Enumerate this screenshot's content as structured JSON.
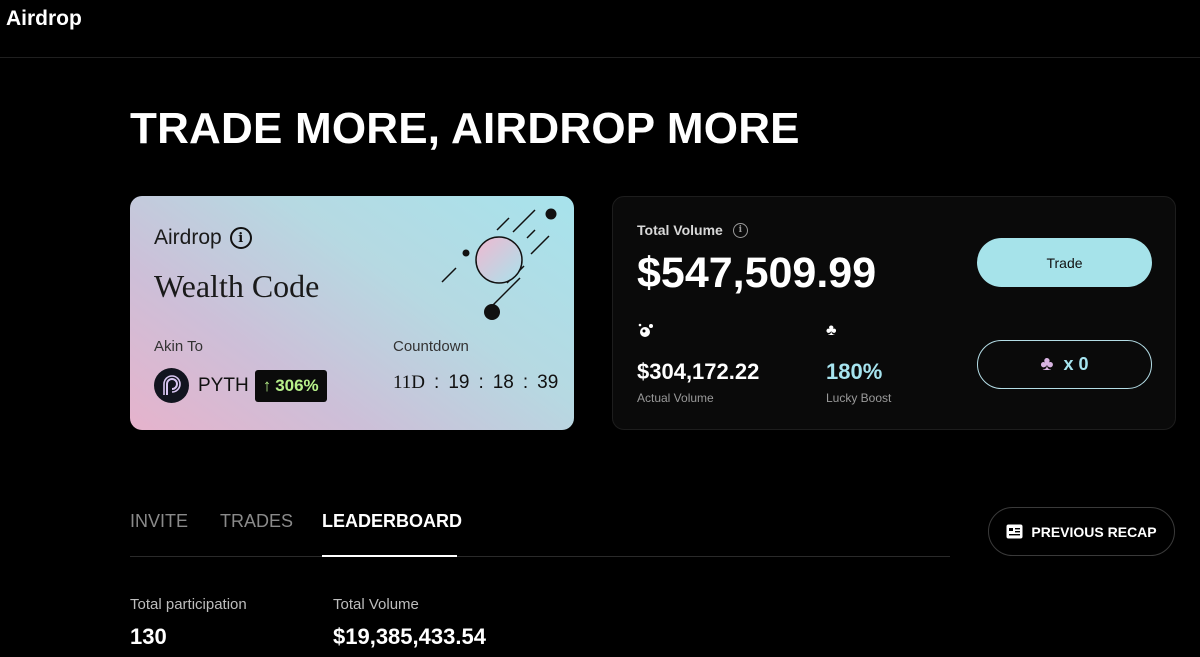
{
  "app": {
    "title": "Airdrop"
  },
  "hero": {
    "title": "TRADE MORE, AIRDROP MORE"
  },
  "airdrop_card": {
    "label": "Airdrop",
    "name": "Wealth Code",
    "akin_label": "Akin To",
    "token_symbol": "PYTH",
    "change_pct": "306%",
    "change_color": "#b7f08a",
    "countdown_label": "Countdown",
    "countdown": {
      "days": "11D",
      "hours": "19",
      "minutes": "18",
      "seconds": "39",
      "separator": ":"
    }
  },
  "volume_card": {
    "total_label": "Total Volume",
    "total_value": "$547,509.99",
    "actual_value": "$304,172.22",
    "actual_label": "Actual Volume",
    "boost_value": "180%",
    "boost_label": "Lucky Boost",
    "trade_label": "Trade",
    "clover_count": "x 0",
    "accent_color": "#a6e3ea"
  },
  "tabs": [
    {
      "label": "INVITE",
      "active": false
    },
    {
      "label": "TRADES",
      "active": false
    },
    {
      "label": "LEADERBOARD",
      "active": true
    }
  ],
  "recap_button": {
    "label": "PREVIOUS RECAP"
  },
  "summary": {
    "participation_label": "Total participation",
    "participation_value": "130",
    "volume_label": "Total Volume",
    "volume_value": "$19,385,433.54"
  }
}
